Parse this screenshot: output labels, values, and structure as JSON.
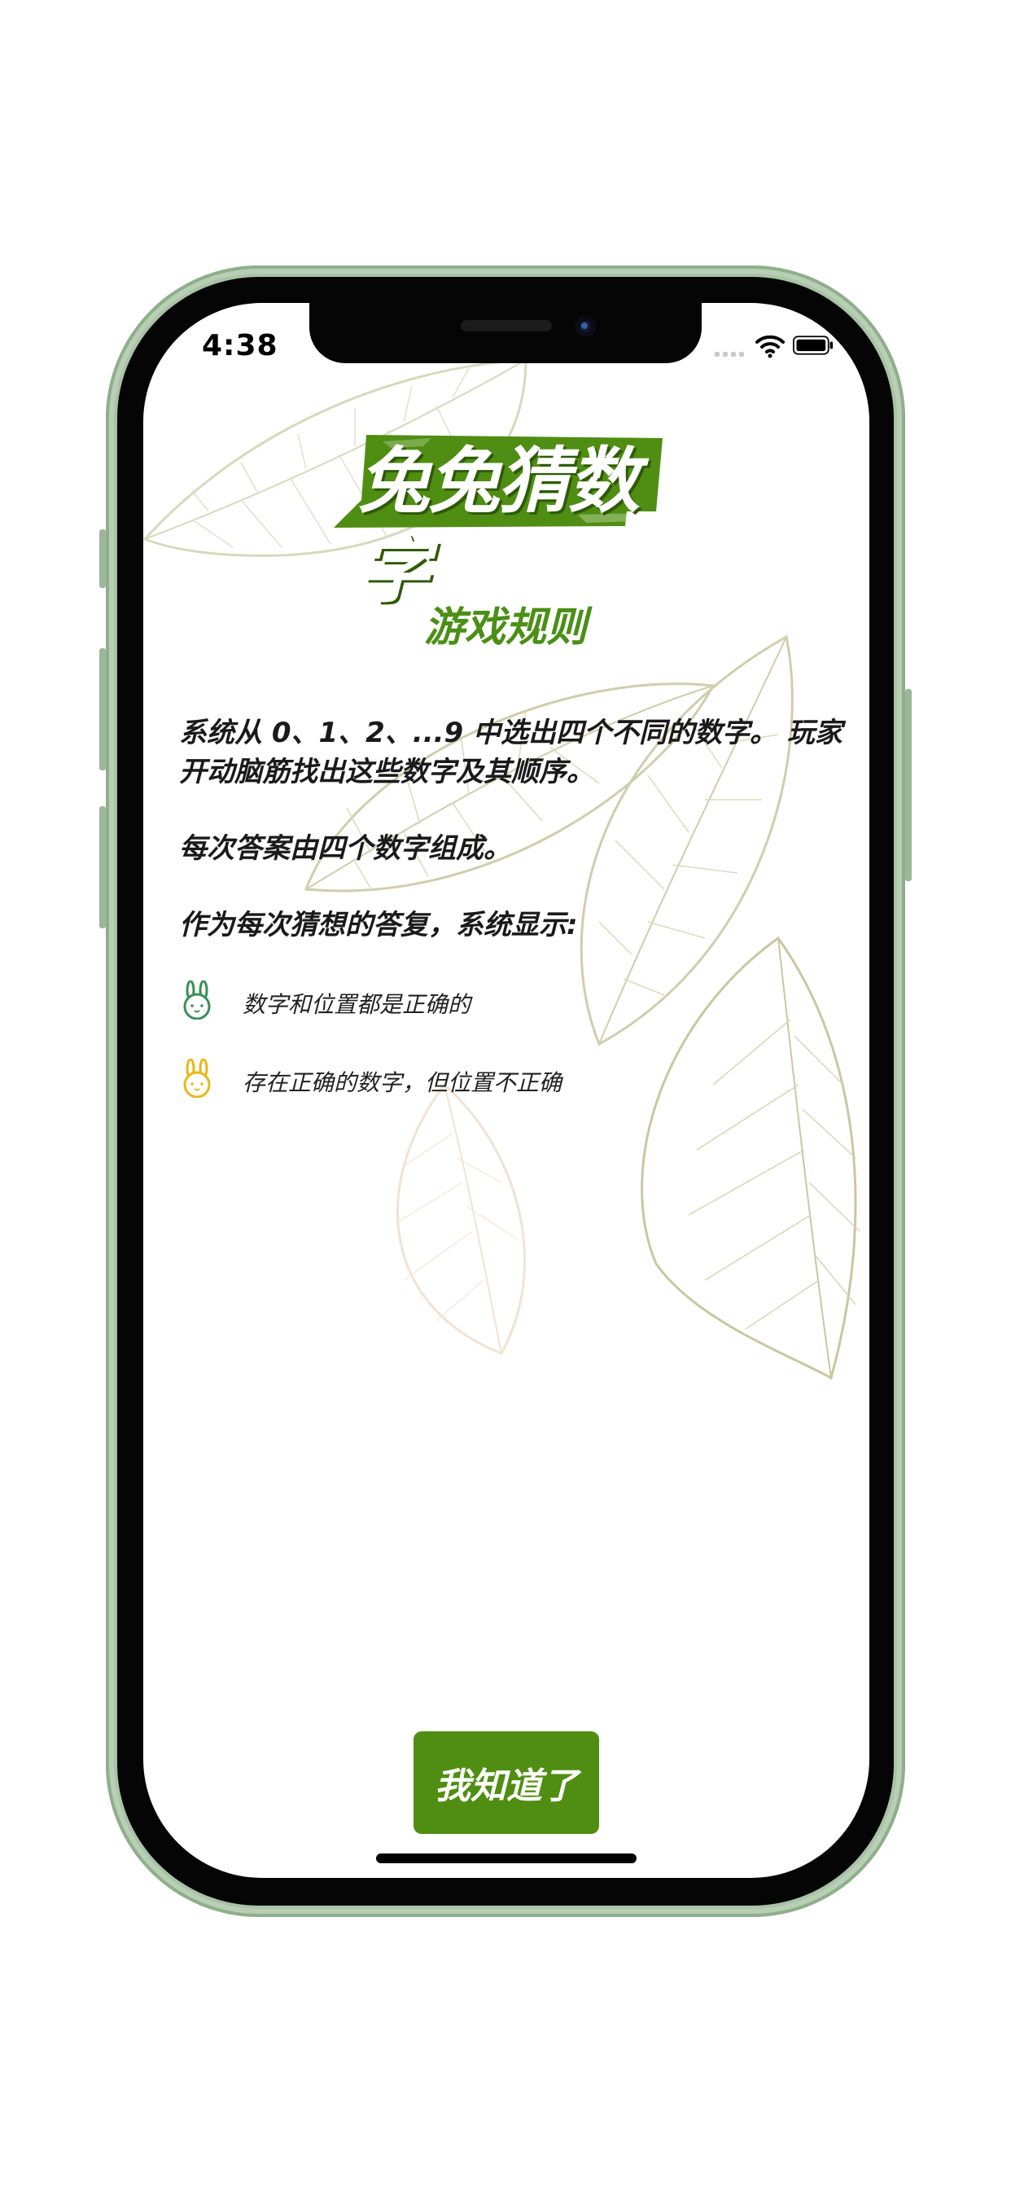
{
  "status_bar": {
    "time": "4:38"
  },
  "app": {
    "title": "兔兔猜数字"
  },
  "rules": {
    "heading": "游戏规则",
    "paragraph_1": "系统从  0、1、2、...9  中选出四个不同的数字。  玩家开动脑筋找出这些数字及其顺序。",
    "paragraph_2": "每次答案由四个数字组成。",
    "paragraph_3": "作为每次猜想的答复，系统显示:"
  },
  "legend": [
    {
      "icon": "green-rabbit-icon",
      "color": "#3a8f5a",
      "text": "数字和位置都是正确的"
    },
    {
      "icon": "yellow-rabbit-icon",
      "color": "#e8b81a",
      "text": "存在正确的数字，但位置不正确"
    }
  ],
  "actions": {
    "ok_label": "我知道了"
  },
  "colors": {
    "accent": "#4f8e12",
    "phone_frame": "#a9c3a6"
  }
}
